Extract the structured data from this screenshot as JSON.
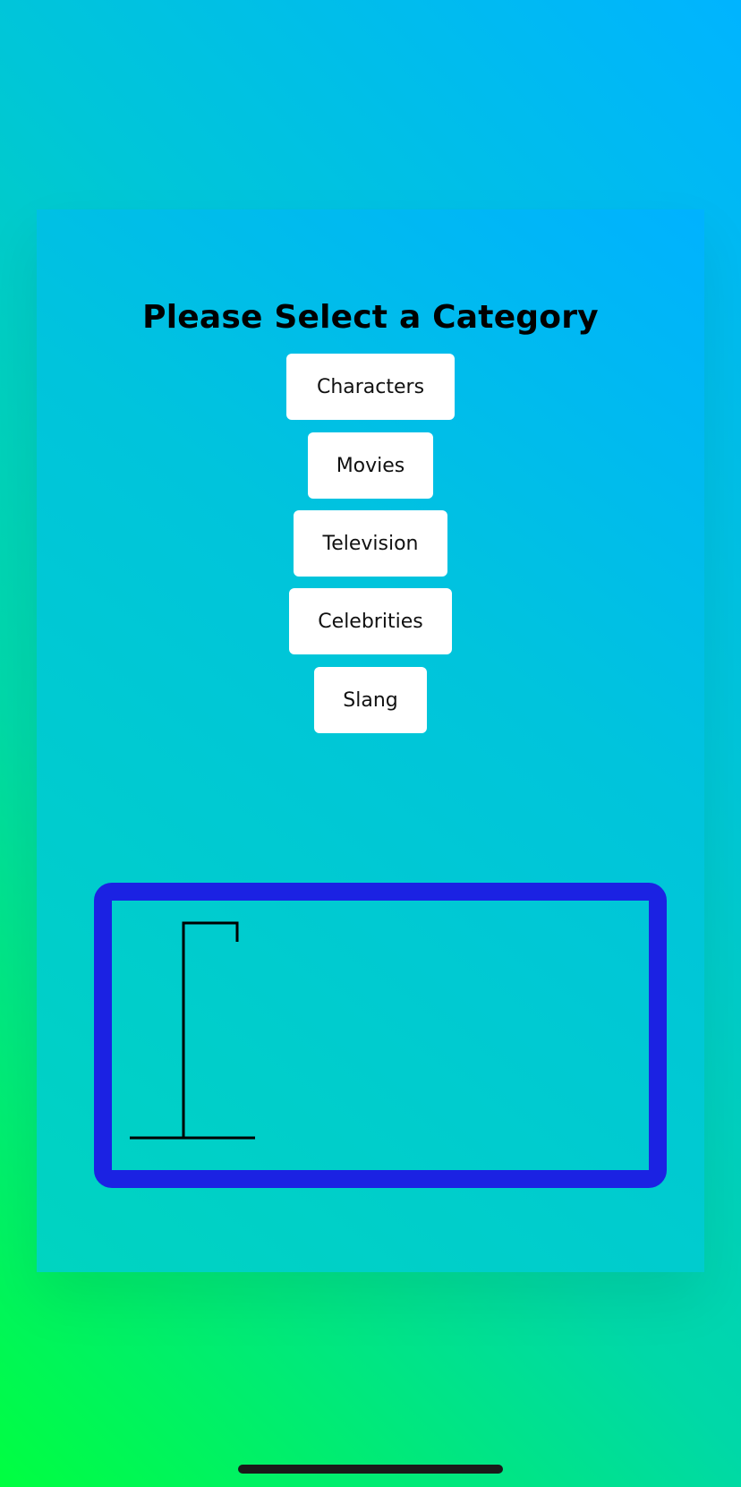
{
  "main": {
    "title": "Please Select a Category",
    "categories": [
      {
        "label": "Characters"
      },
      {
        "label": "Movies"
      },
      {
        "label": "Television"
      },
      {
        "label": "Celebrities"
      },
      {
        "label": "Slang"
      }
    ]
  },
  "colors": {
    "frame_border": "#1B22E3",
    "button_bg": "#FFFFFF",
    "gallows_stroke": "#000000"
  }
}
